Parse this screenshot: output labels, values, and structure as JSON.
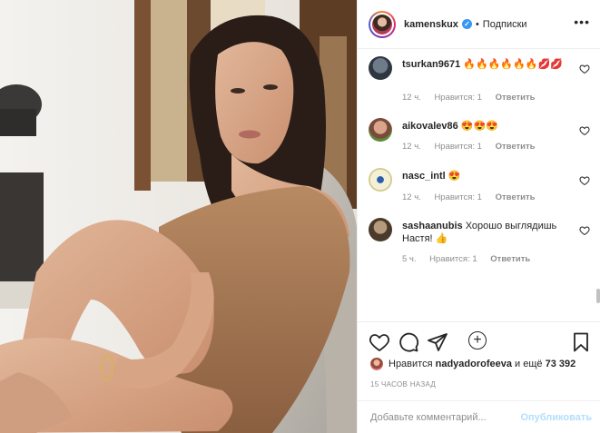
{
  "post": {
    "photo_alt": "Photo",
    "author": {
      "username": "kamenskux",
      "verified_icon": "verified-badge-icon",
      "separator": "•",
      "follow_label": "Подписки",
      "more_icon": "more-horizontal-icon"
    }
  },
  "comments": [
    {
      "username": "tsurkan9671",
      "text": "🔥🔥🔥🔥🔥🔥💋💋",
      "time": "12 ч.",
      "likes": "Нравится: 1",
      "reply_label": "Ответить",
      "avatar_colors": [
        "#6f7b89",
        "#2e3640"
      ]
    },
    {
      "username": "aikovalev86",
      "text": "😍😍😍",
      "time": "12 ч.",
      "likes": "Нравится: 1",
      "reply_label": "Ответить",
      "avatar_colors": [
        "#d9a58a",
        "#7a4b3c"
      ]
    },
    {
      "username": "nasc_intl",
      "text": "😍",
      "time": "12 ч.",
      "likes": "Нравится: 1",
      "reply_label": "Ответить",
      "avatar_colors": [
        "#f3f0d8",
        "#2a5fa8"
      ]
    },
    {
      "username": "sashaanubis",
      "text": "Хорошо выглядишь Настя! 👍",
      "time": "5 ч.",
      "likes": "Нравится: 1",
      "reply_label": "Ответить",
      "avatar_colors": [
        "#b69a7c",
        "#4a3a2c"
      ]
    }
  ],
  "load_more_icon": "plus-circle-icon",
  "actions": {
    "like_icon": "heart-icon",
    "comment_icon": "comment-icon",
    "share_icon": "share-icon",
    "save_icon": "bookmark-icon"
  },
  "likes": {
    "prefix": "Нравится",
    "user": "nadyadorofeeva",
    "middle": "и ещё",
    "count": "73 392"
  },
  "time_ago": "15 ЧАСОВ НАЗАД",
  "add_comment": {
    "placeholder": "Добавьте комментарий...",
    "post_label": "Опубликовать"
  },
  "colors": {
    "accent": "#3897f0",
    "muted": "#8e8e8e",
    "text": "#262626",
    "post_disabled": "#b2dffc"
  }
}
